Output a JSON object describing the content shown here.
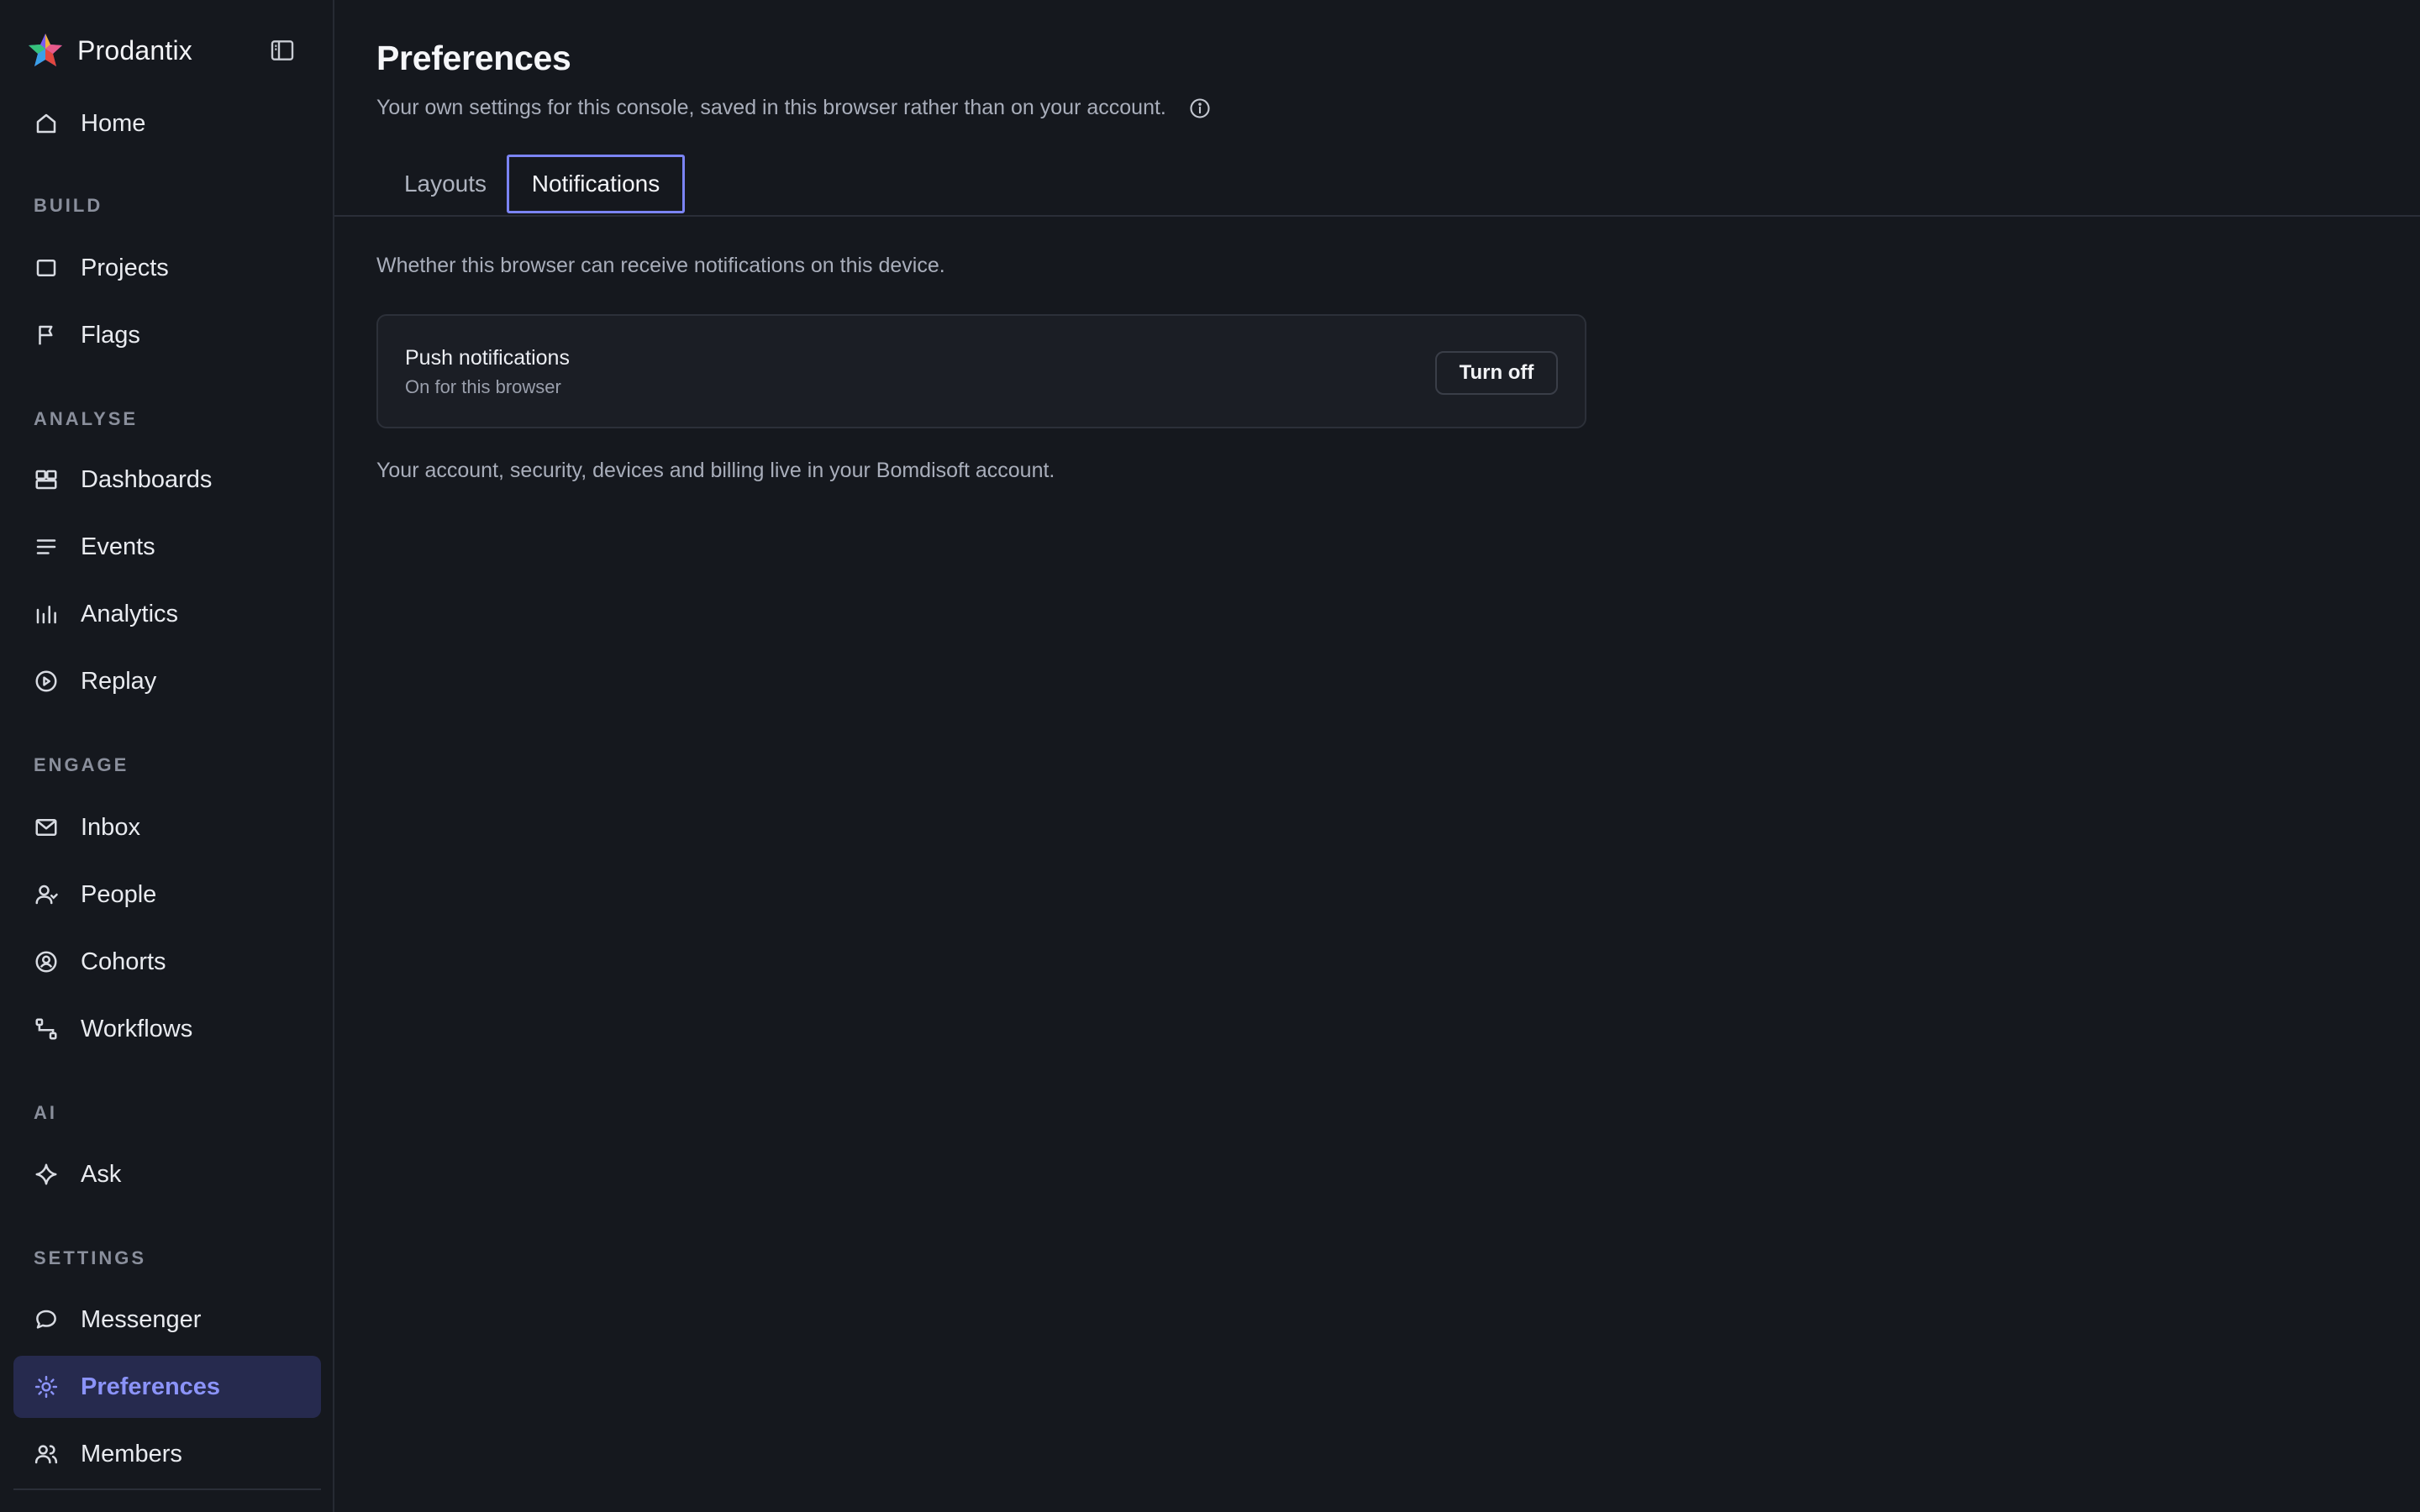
{
  "app": {
    "name": "Prodantix"
  },
  "sidebar": {
    "home": {
      "label": "Home",
      "icon": "home-icon"
    },
    "sections": [
      {
        "label": "BUILD",
        "items": [
          {
            "label": "Projects",
            "icon": "square-icon"
          },
          {
            "label": "Flags",
            "icon": "flag-icon"
          }
        ]
      },
      {
        "label": "ANALYSE",
        "items": [
          {
            "label": "Dashboards",
            "icon": "dashboard-icon"
          },
          {
            "label": "Events",
            "icon": "list-icon"
          },
          {
            "label": "Analytics",
            "icon": "bar-chart-icon"
          },
          {
            "label": "Replay",
            "icon": "play-circle-icon"
          }
        ]
      },
      {
        "label": "ENGAGE",
        "items": [
          {
            "label": "Inbox",
            "icon": "mail-icon"
          },
          {
            "label": "People",
            "icon": "user-icon"
          },
          {
            "label": "Cohorts",
            "icon": "cohort-icon"
          },
          {
            "label": "Workflows",
            "icon": "workflow-icon"
          }
        ]
      },
      {
        "label": "AI",
        "items": [
          {
            "label": "Ask",
            "icon": "sparkle-icon"
          }
        ]
      },
      {
        "label": "SETTINGS",
        "items": [
          {
            "label": "Messenger",
            "icon": "chat-icon"
          },
          {
            "label": "Preferences",
            "icon": "sun-icon",
            "active": true
          },
          {
            "label": "Members",
            "icon": "users-icon"
          }
        ]
      }
    ]
  },
  "page": {
    "title": "Preferences",
    "subtitle": "Your own settings for this console, saved in this browser rather than on your account.",
    "tabs": [
      {
        "label": "Layouts"
      },
      {
        "label": "Notifications",
        "selected": true
      }
    ],
    "description": "Whether this browser can receive notifications on this device.",
    "card": {
      "title": "Push notifications",
      "status": "On for this browser",
      "button_label": "Turn off"
    },
    "footer_note": "Your account, security, devices and billing live in your Bomdisoft account."
  },
  "colors": {
    "background": "#15181e",
    "accent": "#7b84f5",
    "active_bg": "#262a4e"
  }
}
